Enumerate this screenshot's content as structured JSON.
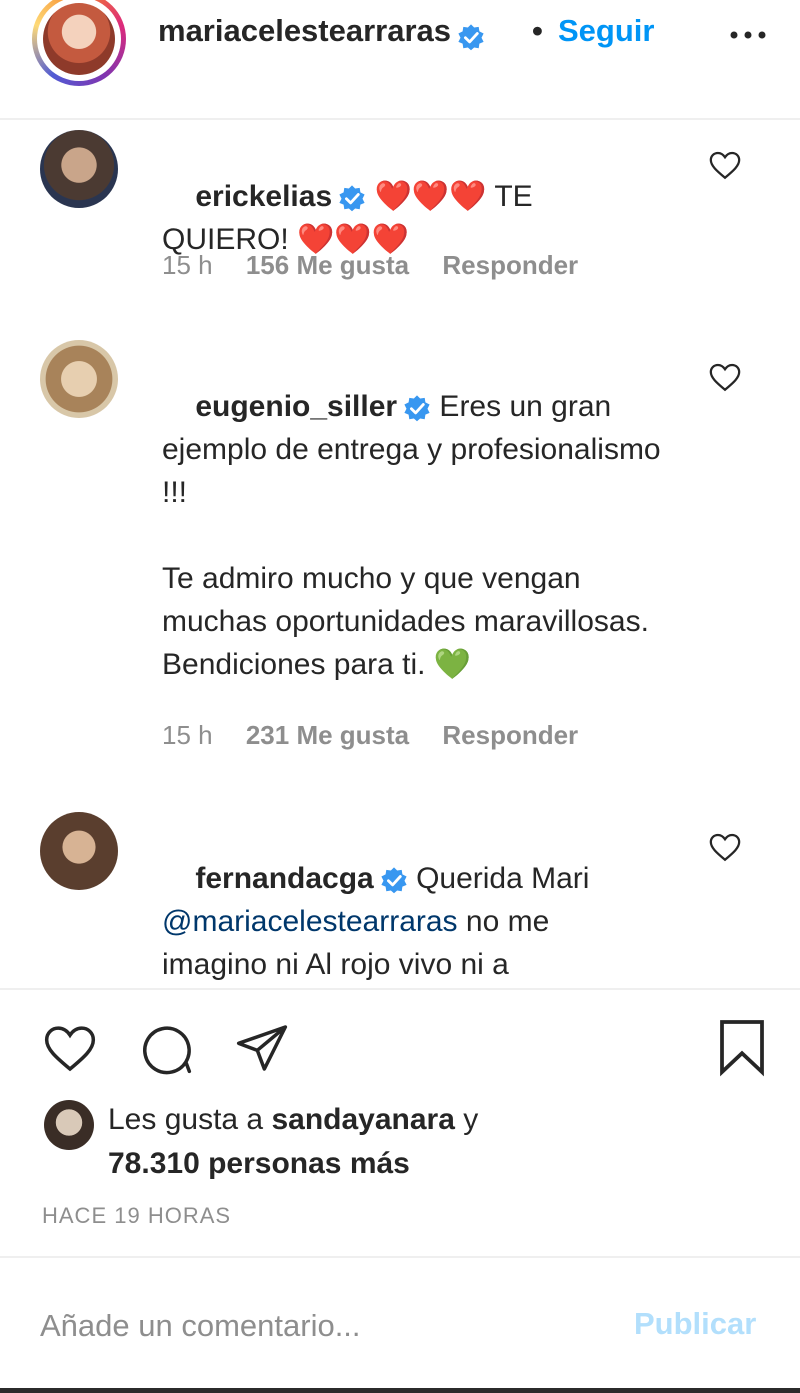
{
  "header": {
    "username": "mariacelestearraras",
    "dot": "•",
    "follow_label": "Seguir",
    "more_icon": "more-horizontal-icon"
  },
  "comments": [
    {
      "username": "erickelias",
      "text_before": " ❤️❤️❤️ TE QUIERO! ❤️❤️❤️",
      "time": "15 h",
      "likes": "156 Me gusta",
      "reply": "Responder"
    },
    {
      "username": "eugenio_siller",
      "text_before": " Eres un gran ejemplo de entrega y profesionalismo !!!\n\nTe admiro mucho y que vengan muchas oportunidades maravillosas. Bendiciones para ti. 💚",
      "time": "15 h",
      "likes": "231 Me gusta",
      "reply": "Responder"
    },
    {
      "username": "fernandacga",
      "text_before": " Querida Mari ",
      "mention": "@mariacelestearraras",
      "text_after": " no me imagino ni Al rojo vivo ni a Telemundo sin ti . Eres una"
    }
  ],
  "likes_line": {
    "prefix": "Les gusta a ",
    "user": "sandayanara",
    "middle": " y",
    "count": "78.310 personas más"
  },
  "time_ago": "HACE 19 HORAS",
  "comment_box": {
    "placeholder": "Añade un comentario...",
    "publish_label": "Publicar"
  },
  "colors": {
    "accent": "#0095f6",
    "publish_disabled": "#b2dffc",
    "verified": "#3897f0",
    "muted": "#8e8e8e"
  }
}
